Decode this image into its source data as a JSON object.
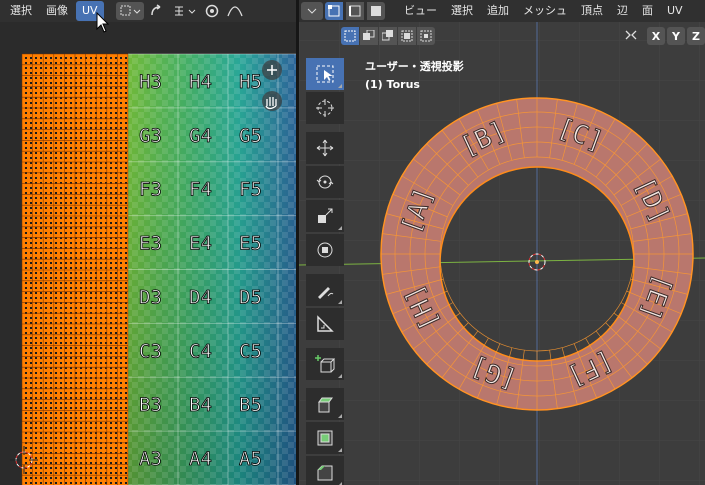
{
  "uv_editor": {
    "menu": [
      {
        "label": "選択",
        "active": false
      },
      {
        "label": "画像",
        "active": false
      },
      {
        "label": "UV",
        "active": true
      }
    ],
    "grid_rows": [
      "H",
      "G",
      "F",
      "E",
      "D",
      "C",
      "B",
      "A"
    ],
    "grid_cols": [
      "3",
      "4",
      "5"
    ]
  },
  "viewport": {
    "menu": [
      "ビュー",
      "選択",
      "追加",
      "メッシュ",
      "頂点",
      "辺",
      "面",
      "UV"
    ],
    "view_title": "ユーザー・透視投影",
    "object_name": "(1) Torus",
    "axes": [
      "X",
      "Y",
      "Z"
    ],
    "torus_labels": [
      "A",
      "B",
      "C",
      "D",
      "E",
      "F",
      "G",
      "H"
    ],
    "tools": [
      {
        "name": "select-box-tool",
        "icon": "select-box-icon",
        "active": true
      },
      {
        "name": "cursor-tool",
        "icon": "cursor-icon",
        "active": false
      },
      {
        "name": "move-tool",
        "icon": "move-icon",
        "active": false
      },
      {
        "name": "rotate-tool",
        "icon": "rotate-icon",
        "active": false
      },
      {
        "name": "scale-tool",
        "icon": "scale-icon",
        "active": false
      },
      {
        "name": "transform-tool",
        "icon": "transform-icon",
        "active": false
      },
      {
        "name": "annotate-tool",
        "icon": "annotate-icon",
        "active": false
      },
      {
        "name": "measure-tool",
        "icon": "measure-icon",
        "active": false
      },
      {
        "name": "add-cube-tool",
        "icon": "add-cube-icon",
        "active": false
      },
      {
        "name": "extrude-tool",
        "icon": "extrude-icon",
        "active": false
      },
      {
        "name": "inset-tool",
        "icon": "inset-icon",
        "active": false
      },
      {
        "name": "bevel-tool",
        "icon": "bevel-icon",
        "active": false
      }
    ]
  },
  "colors": {
    "accent": "#4772b3",
    "selection_orange": "#ff8c00",
    "header_bg": "#303030",
    "viewport_bg": "#3d3d3d"
  }
}
